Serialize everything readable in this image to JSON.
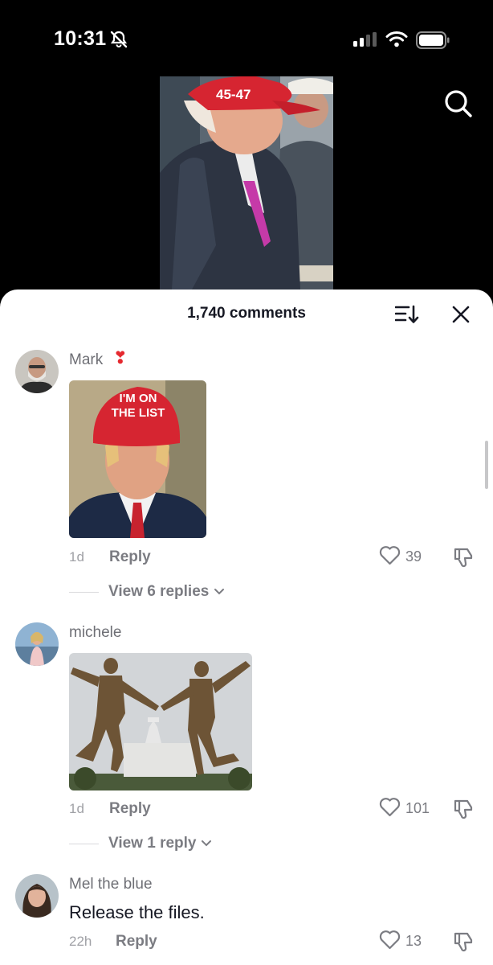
{
  "status_bar": {
    "time": "10:31"
  },
  "sheet": {
    "title": "1,740 comments"
  },
  "comments": [
    {
      "username": "Mark",
      "badge": "❣",
      "image_caption": "I'M ON THE LIST",
      "age": "1d",
      "reply_label": "Reply",
      "likes": "39",
      "view_replies": "View 6 replies"
    },
    {
      "username": "michele",
      "age": "1d",
      "reply_label": "Reply",
      "likes": "101",
      "view_replies": "View 1 reply"
    },
    {
      "username": "Mel the blue",
      "text": "Release the files.",
      "age": "22h",
      "reply_label": "Reply",
      "likes": "13"
    }
  ],
  "video": {
    "hat_text": "45-47"
  },
  "colors": {
    "accent_red": "#d62531",
    "text_primary": "#161823",
    "text_secondary": "#7b7c82"
  },
  "icons": [
    "bell-muted-icon",
    "signal-icon",
    "wifi-icon",
    "battery-icon",
    "search-icon",
    "sort-icon",
    "close-icon",
    "heart-icon",
    "dislike-icon",
    "chevron-down-icon"
  ]
}
